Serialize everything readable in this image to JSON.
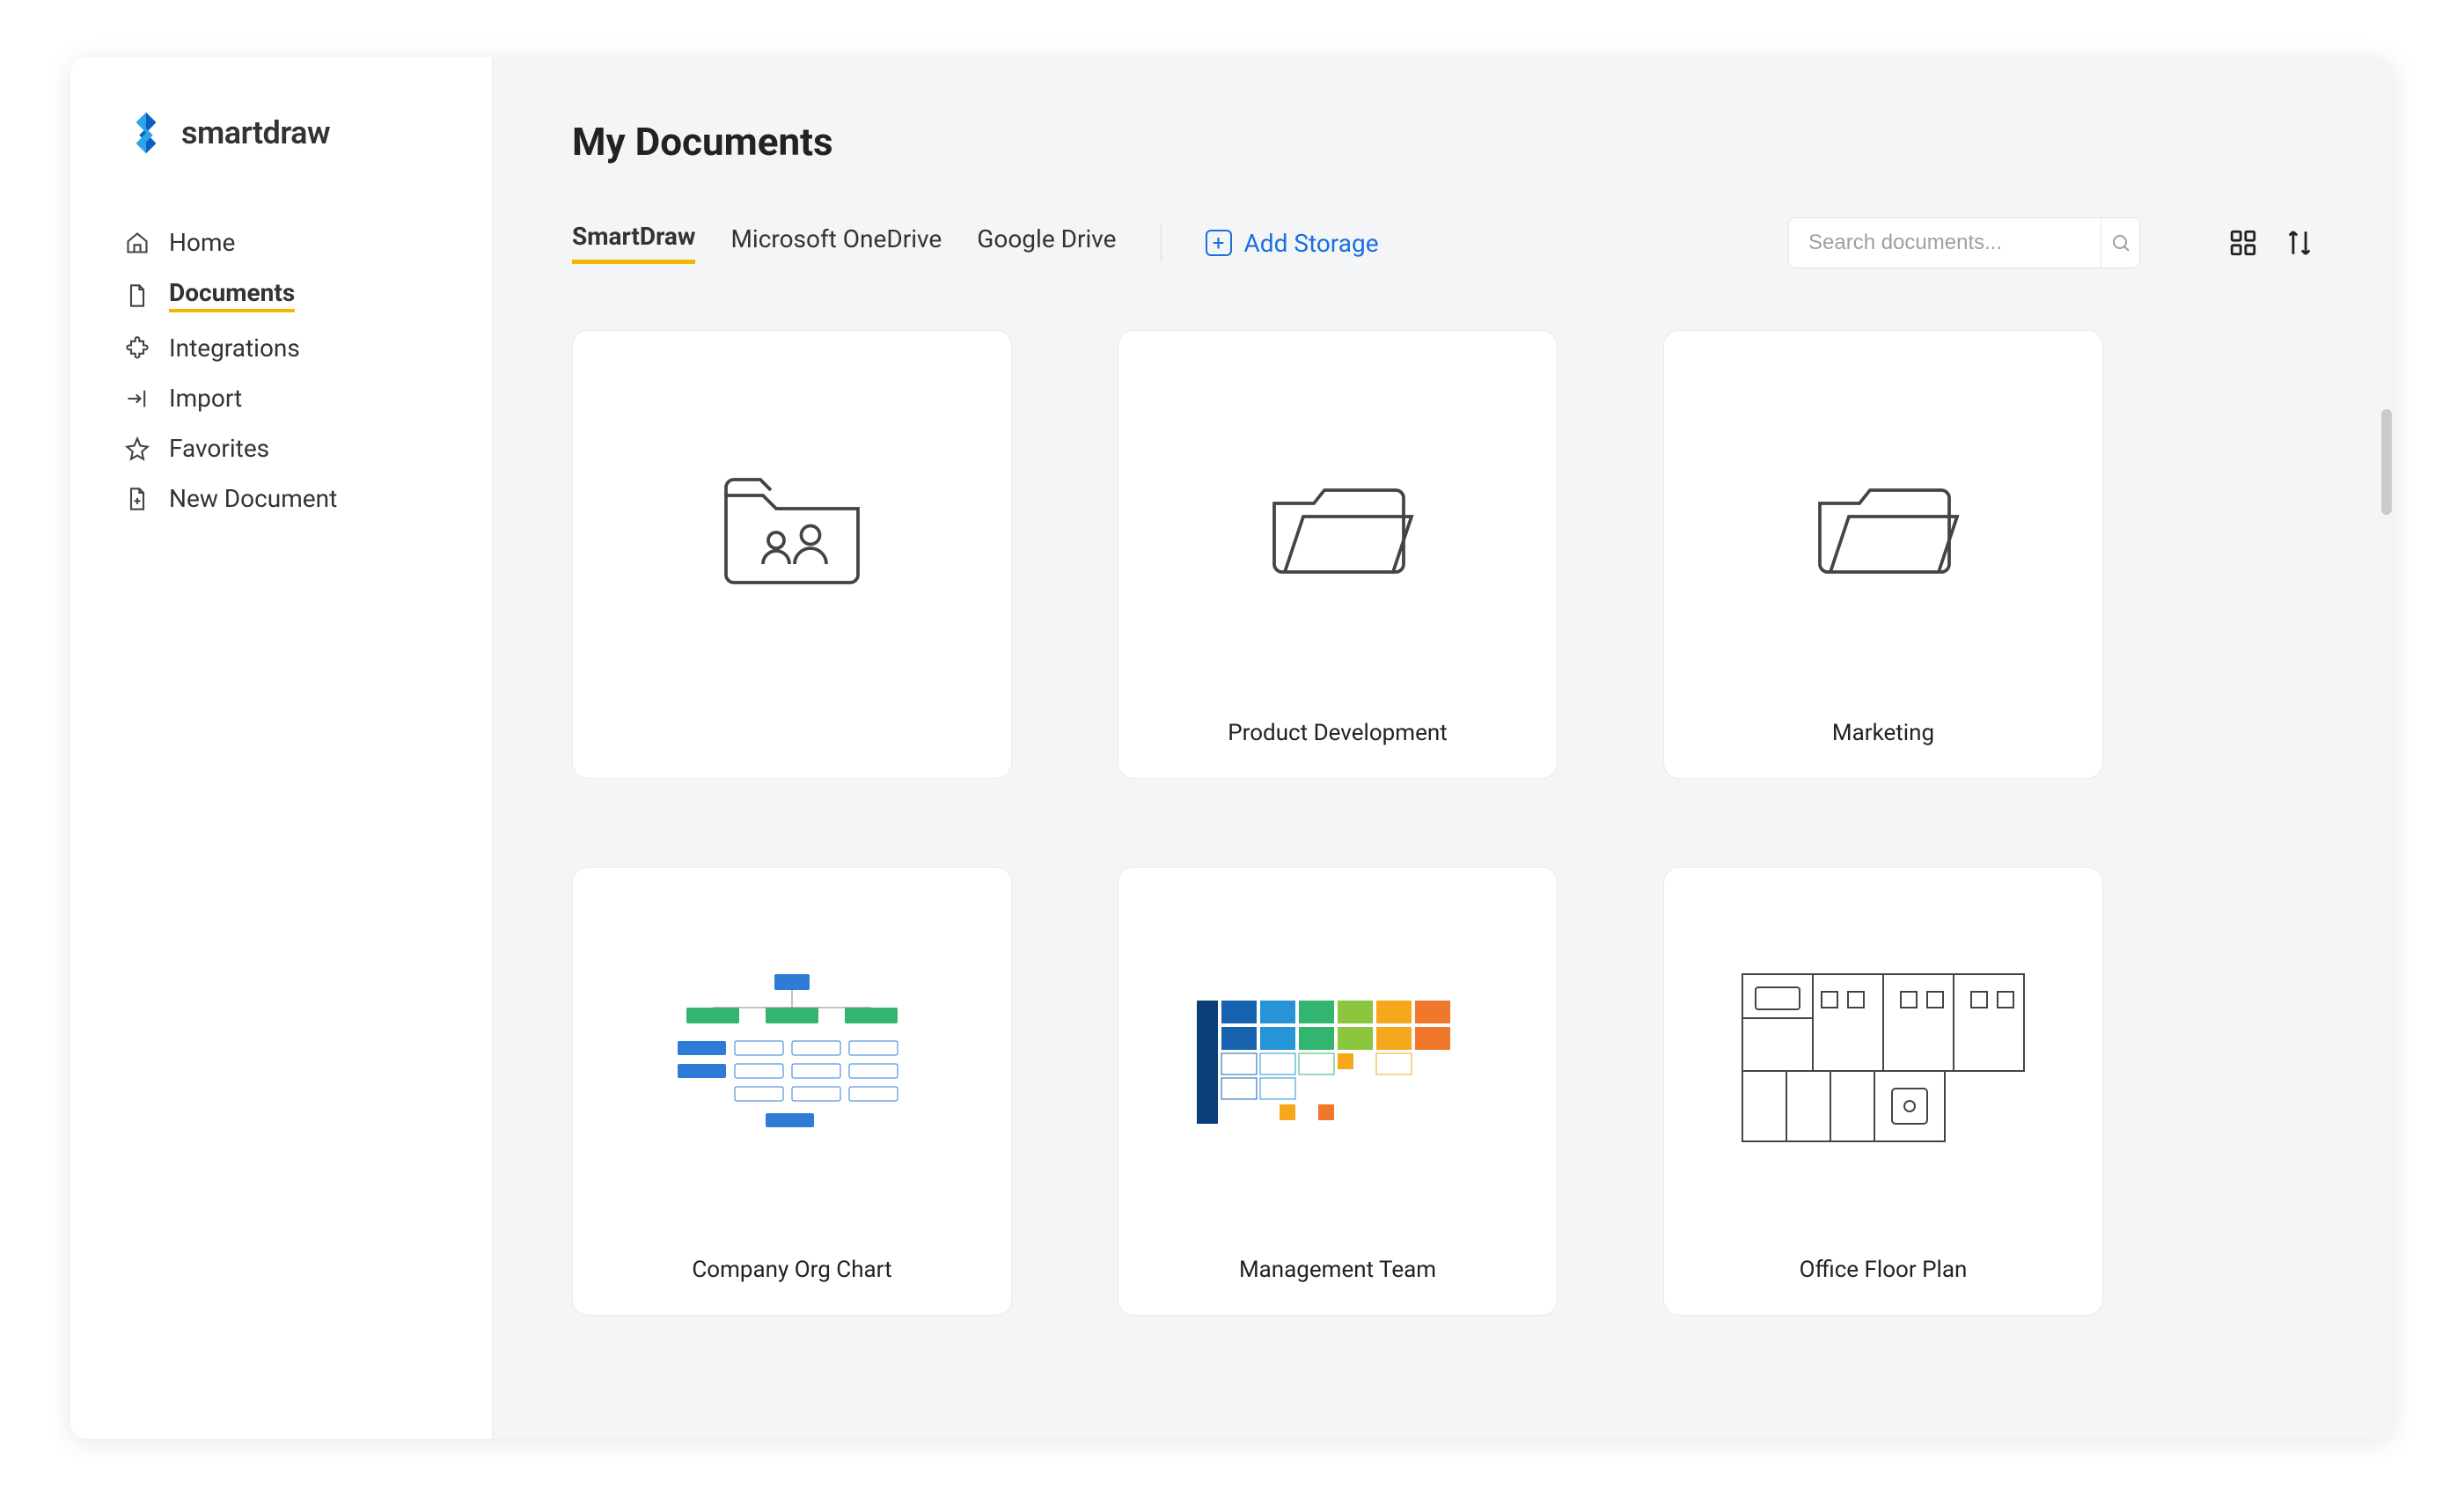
{
  "brand": {
    "name": "smartdraw"
  },
  "sidebar": {
    "items": [
      {
        "label": "Home",
        "icon": "home-icon"
      },
      {
        "label": "Documents",
        "icon": "document-icon",
        "active": true
      },
      {
        "label": "Integrations",
        "icon": "puzzle-icon"
      },
      {
        "label": "Import",
        "icon": "import-icon"
      },
      {
        "label": "Favorites",
        "icon": "star-icon"
      },
      {
        "label": "New Document",
        "icon": "new-document-icon"
      }
    ]
  },
  "main": {
    "title": "My Documents",
    "tabs": [
      {
        "label": "SmartDraw",
        "active": true
      },
      {
        "label": "Microsoft OneDrive"
      },
      {
        "label": "Google Drive"
      }
    ],
    "add_storage_label": "Add Storage",
    "search": {
      "placeholder": "Search documents..."
    }
  },
  "items": [
    {
      "label": "",
      "kind": "shared-folder"
    },
    {
      "label": "Product Development",
      "kind": "folder"
    },
    {
      "label": "Marketing",
      "kind": "folder"
    },
    {
      "label": "Company Org Chart",
      "kind": "doc-orgchart"
    },
    {
      "label": "Management Team",
      "kind": "doc-mgmt"
    },
    {
      "label": "Office Floor Plan",
      "kind": "doc-floorplan"
    }
  ]
}
